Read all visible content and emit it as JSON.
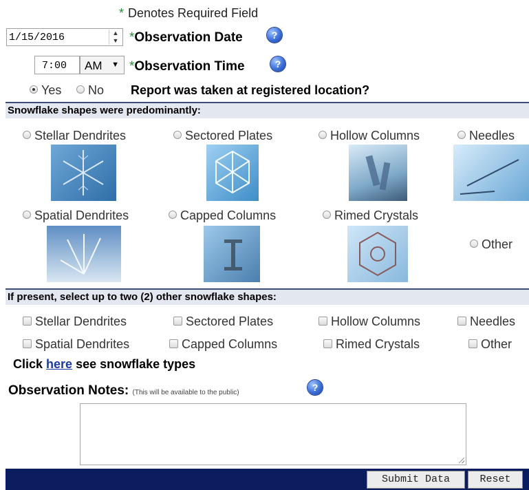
{
  "required_note": "Denotes Required Field",
  "required_star": "*",
  "date": {
    "value": "1/15/2016",
    "label": "Observation Date"
  },
  "time": {
    "value": "7:00",
    "ampm": "AM",
    "label": "Observation Time"
  },
  "location": {
    "yes": "Yes",
    "no": "No",
    "selected": "Yes",
    "question": "Report was taken at registered location?"
  },
  "shapes_section": {
    "header": "Snowflake shapes were predominantly:",
    "options": [
      "Stellar Dendrites",
      "Sectored Plates",
      "Hollow Columns",
      "Needles",
      "Spatial Dendrites",
      "Capped Columns",
      "Rimed Crystals",
      "Other"
    ]
  },
  "other_section": {
    "header": "If present, select up to two (2) other snowflake shapes:",
    "options": [
      "Stellar Dendrites",
      "Sectored Plates",
      "Hollow Columns",
      "Needles",
      "Spatial Dendrites",
      "Capped Columns",
      "Rimed Crystals",
      "Other"
    ]
  },
  "click_here": {
    "prefix": "Click",
    "link": "here",
    "suffix": "see snowflake types"
  },
  "notes": {
    "label": "Observation Notes:",
    "sub": "(This will be available to the public)",
    "value": ""
  },
  "help_glyph": "?",
  "buttons": {
    "submit": "Submit Data",
    "reset": "Reset"
  },
  "icons": {
    "help": "help-icon",
    "spinner": "spinner-icon",
    "dropdown": "chevron-down-icon",
    "resize": "resize-grip-icon"
  }
}
